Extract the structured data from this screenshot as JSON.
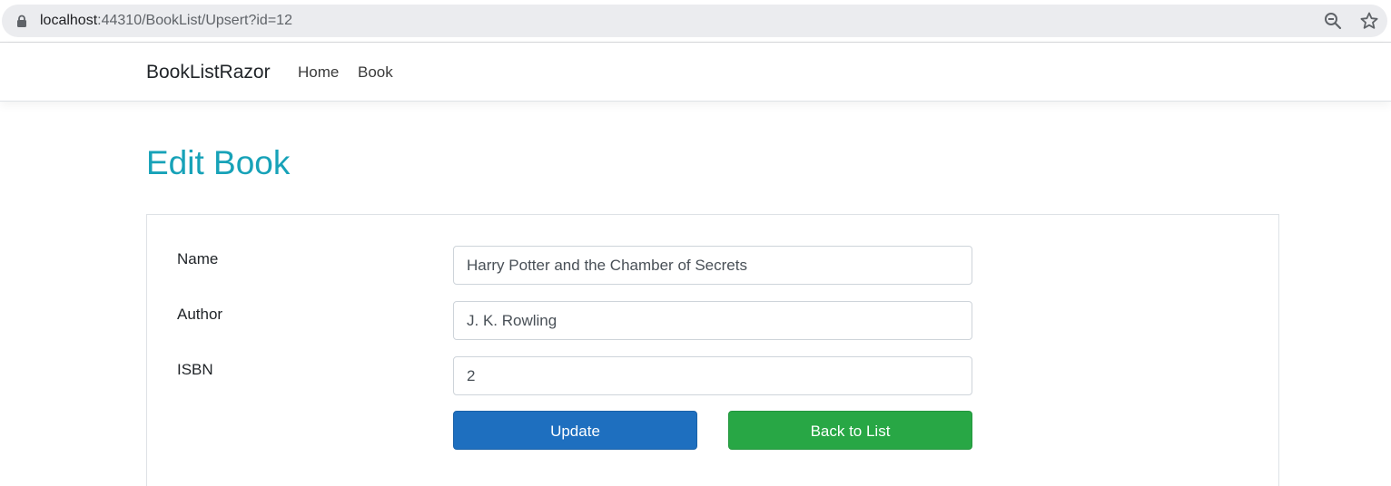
{
  "browser": {
    "url_host": "localhost",
    "url_rest": ":44310/BookList/Upsert?id=12",
    "icons": {
      "lock": "lock-icon",
      "zoom": "zoom-out-icon",
      "bookmark": "star-icon"
    }
  },
  "navbar": {
    "brand": "BookListRazor",
    "links": [
      {
        "label": "Home"
      },
      {
        "label": "Book"
      }
    ]
  },
  "page": {
    "title": "Edit Book",
    "title_color": "#17a2b8"
  },
  "form": {
    "fields": [
      {
        "label": "Name",
        "value": "Harry Potter and the Chamber of Secrets"
      },
      {
        "label": "Author",
        "value": "J. K. Rowling"
      },
      {
        "label": "ISBN",
        "value": "2"
      }
    ],
    "buttons": {
      "update": {
        "label": "Update",
        "color": "#1e6fbf"
      },
      "back": {
        "label": "Back to List",
        "color": "#28a745"
      }
    }
  }
}
